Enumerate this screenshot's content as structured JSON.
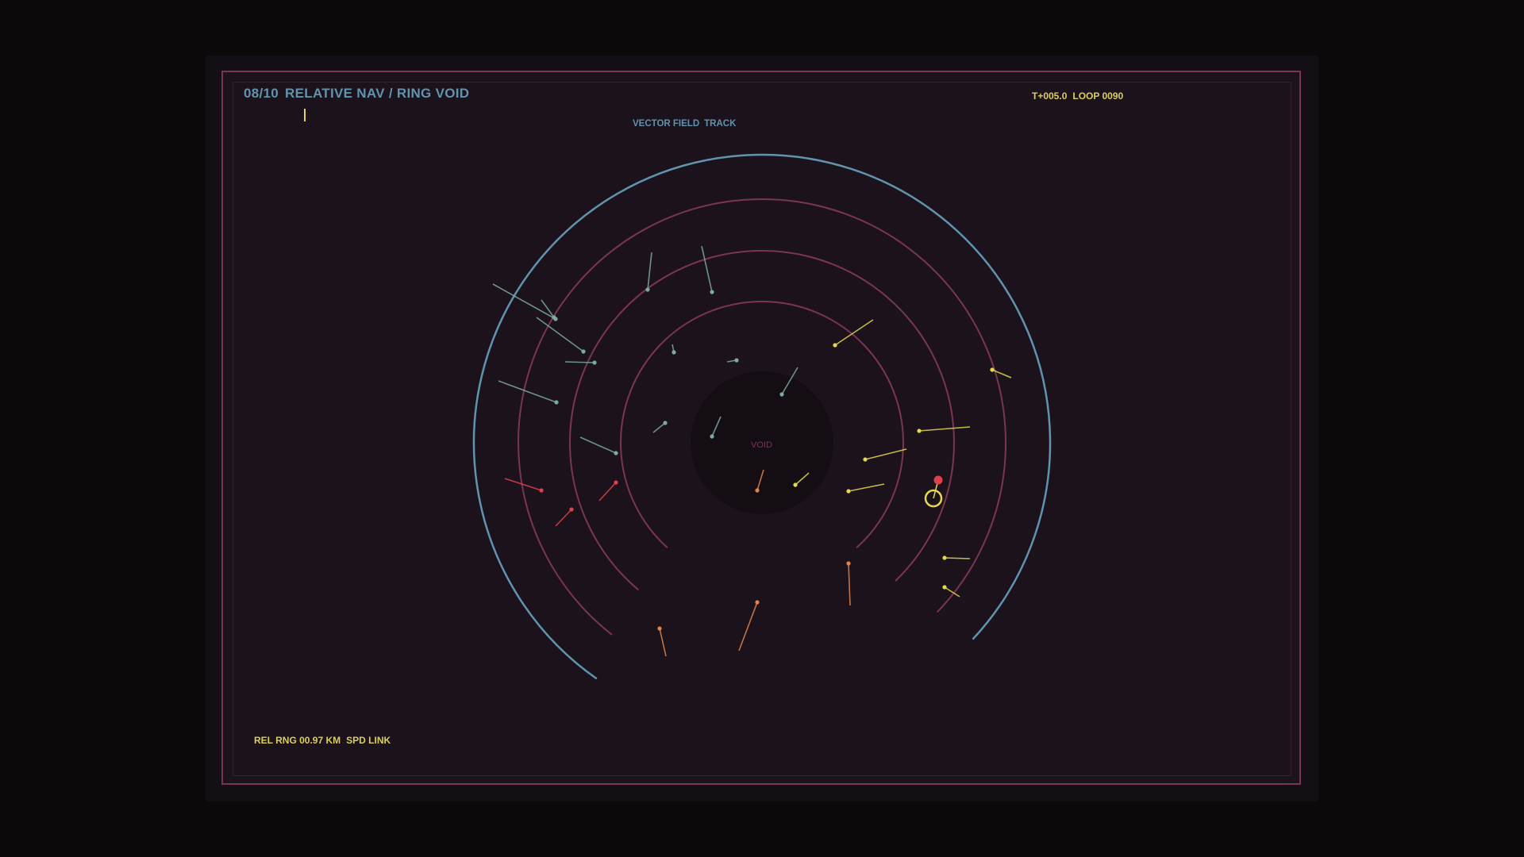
{
  "hud": {
    "counter": "08/10",
    "title": "RELATIVE NAV / RING VOID",
    "time": "T+005.0",
    "loop": "LOOP 0090",
    "mode_a": "VECTOR FIELD",
    "mode_b": "TRACK",
    "range": "REL RNG 00.97 KM",
    "link": "SPD LINK"
  },
  "field": {
    "void_label": "VOID"
  },
  "colors": {
    "background": "#0b090a",
    "frame": "#7a3553",
    "outer_ring": "#5f93ae",
    "inner_ring": "#7a3553",
    "void": "#140e14",
    "teal": "#7aaaa0",
    "yellow": "#e3d84e",
    "orange": "#e0844a",
    "red": "#e0404e"
  },
  "icons": {
    "player": "player-reticle-icon",
    "target": "target-marker-icon"
  }
}
